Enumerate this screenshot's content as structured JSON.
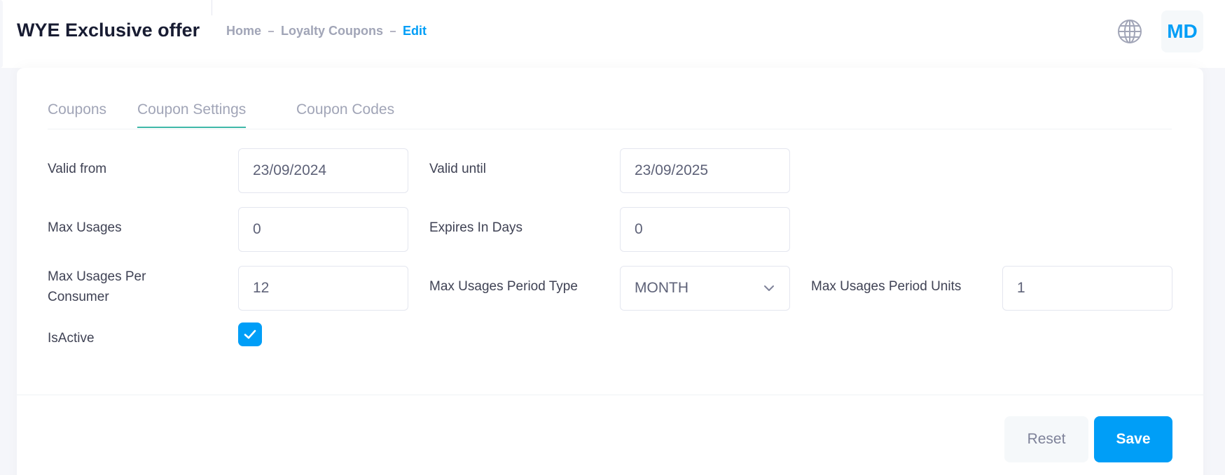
{
  "header": {
    "title": "WYE Exclusive offer",
    "breadcrumb": [
      "Home",
      "Loyalty Coupons",
      "Edit"
    ],
    "avatar_initials": "MD",
    "language_icon": "globe-icon"
  },
  "tabs": [
    {
      "label": "Coupons",
      "active": false
    },
    {
      "label": "Coupon Settings",
      "active": true
    },
    {
      "label": "Coupon Codes",
      "active": false
    }
  ],
  "form": {
    "valid_from": {
      "label": "Valid from",
      "value": "23/09/2024"
    },
    "valid_until": {
      "label": "Valid until",
      "value": "23/09/2025"
    },
    "max_usages": {
      "label": "Max Usages",
      "value": "0"
    },
    "expires_in_days": {
      "label": "Expires In Days",
      "value": "0"
    },
    "max_usages_per_consumer": {
      "label_line1": "Max Usages Per",
      "label_line2": "Consumer",
      "value": "12"
    },
    "max_usages_period_type": {
      "label": "Max Usages Period Type",
      "value": "MONTH"
    },
    "max_usages_period_units": {
      "label": "Max Usages Period Units",
      "value": "1"
    },
    "is_active": {
      "label": "IsActive",
      "checked": true
    }
  },
  "actions": {
    "reset_label": "Reset",
    "save_label": "Save"
  },
  "colors": {
    "accent": "#009ef7",
    "tab_underline": "#3fb8a8"
  }
}
